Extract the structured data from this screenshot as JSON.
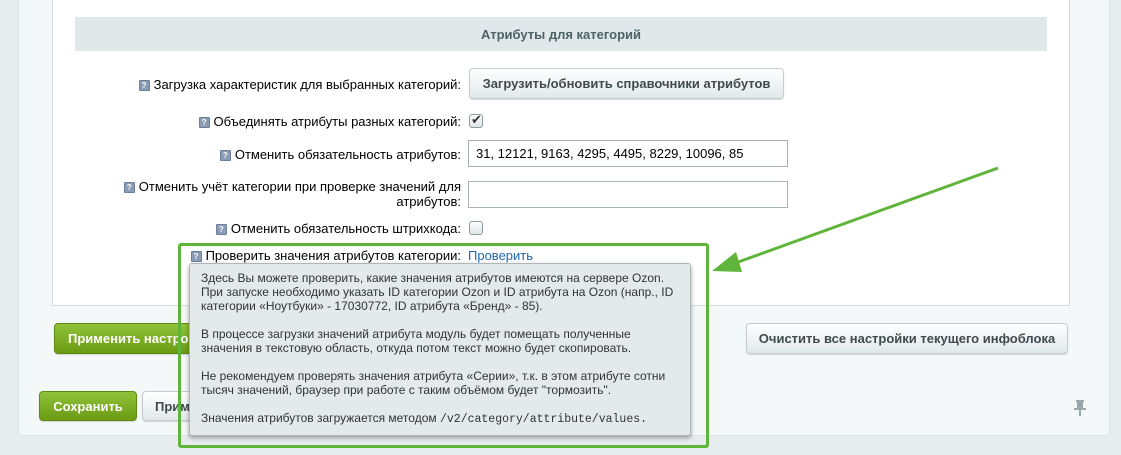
{
  "section": {
    "title": "Атрибуты для категорий"
  },
  "rows": {
    "load": {
      "label": "Загрузка характеристик для выбранных категорий:",
      "button": "Загрузить/обновить справочники атрибутов"
    },
    "merge": {
      "label": "Объединять атрибуты разных категорий:",
      "checked": true
    },
    "required": {
      "label": "Отменить обязательность атрибутов:",
      "value": "31, 12121, 9163, 4295, 4495, 8229, 10096, 85"
    },
    "cancel_category": {
      "label": "Отменить учёт категории при проверке значений для атрибутов:",
      "value": ""
    },
    "barcode": {
      "label": "Отменить обязательность штрихкода:",
      "checked": false
    },
    "check": {
      "label": "Проверить значения атрибутов категории:",
      "link": "Проверить"
    }
  },
  "hint_glyph": "?",
  "buttons": {
    "apply": "Применить настройки",
    "clear": "Очистить все настройки текущего инфоблока",
    "save": "Сохранить",
    "apply_bottom": "Применить"
  },
  "tooltip": {
    "p1": "Здесь Вы можете проверить, какие значения атрибутов имеются на сервере Ozon. При запуске необходимо указать ID категории Ozon и ID атрибута на Ozon (напр., ID категории «Ноутбуки» - 17030772, ID атрибута «Бренд» - 85).",
    "p2": "В процессе загрузки значений атрибута модуль будет помещать полученные значения в текстовую область, откуда потом текст можно будет скопировать.",
    "p3": "Не рекомендуем проверять значения атрибута «Серии», т.к. в этом атрибуте сотни тысяч значений, браузер при работе с таким объёмом будет \"тормозить\".",
    "p4_text": "Значения атрибутов загружается методом",
    "p4_code": "/v2/category/attribute/values."
  },
  "icons": [
    "hint-icon",
    "checkmark-icon",
    "pin-icon",
    "arrow-icon"
  ],
  "colors": {
    "highlight": "#5fb43a",
    "green_button": "#7aae25",
    "link": "#2067b0"
  }
}
